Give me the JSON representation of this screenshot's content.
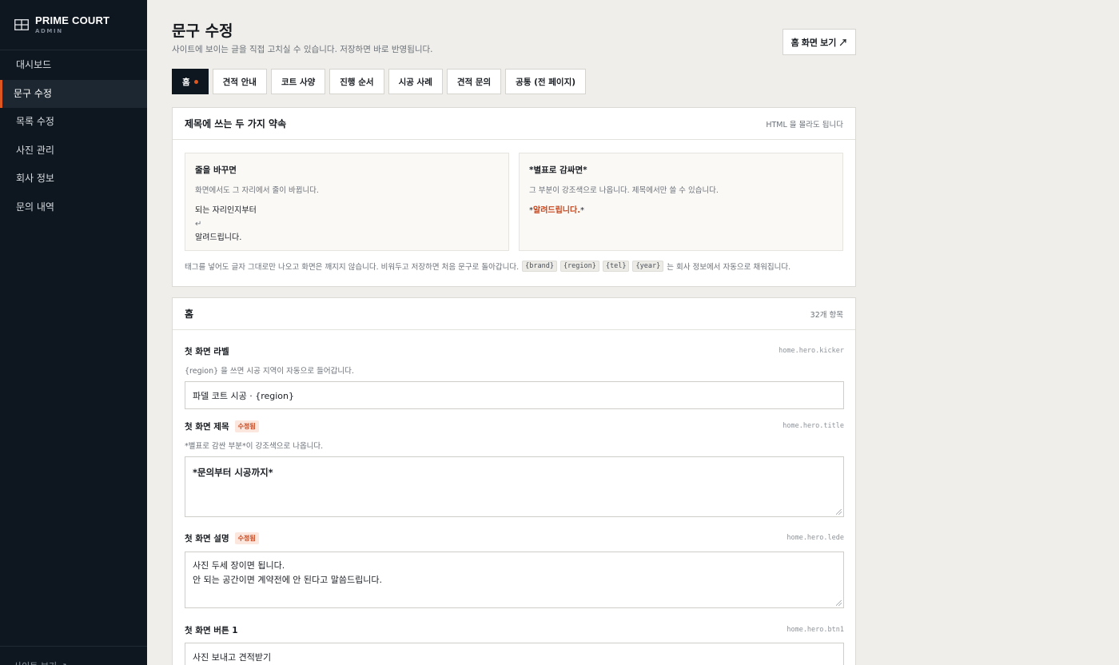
{
  "sidebar": {
    "brand": "PRIME COURT",
    "brand_sub": "ADMIN",
    "logo_icon": "grid-icon",
    "items": [
      {
        "label": "대시보드"
      },
      {
        "label": "문구 수정"
      },
      {
        "label": "목록 수정"
      },
      {
        "label": "사진 관리"
      },
      {
        "label": "회사 정보"
      },
      {
        "label": "문의 내역"
      }
    ],
    "footer_link": "사이트 보기 ↗"
  },
  "header": {
    "title": "문구 수정",
    "subtitle": "사이트에 보이는 글을 직접 고치실 수 있습니다. 저장하면 바로 반영됩니다.",
    "view_button": "홈 화면 보기 ↗"
  },
  "tabs": [
    {
      "label": "홈"
    },
    {
      "label": "견적 안내"
    },
    {
      "label": "코트 사양"
    },
    {
      "label": "진행 순서"
    },
    {
      "label": "시공 사례"
    },
    {
      "label": "견적 문의"
    },
    {
      "label": "공통 (전 페이지)"
    }
  ],
  "rules_card": {
    "title": "제목에 쓰는 두 가지 약속",
    "meta": "HTML 을 몰라도 됩니다",
    "rule1": {
      "title": "줄을 바꾸면",
      "desc": "화면에서도 그 자리에서 줄이 바뀝니다.",
      "ex_line1": "되는 자리인지부터",
      "ex_icon": "↵",
      "ex_line2": "알려드립니다."
    },
    "rule2": {
      "title": "*별표로 감싸면*",
      "desc": "그 부분이 강조색으로 나옵니다. 제목에서만 쓸 수 있습니다.",
      "ex_star_open": "*",
      "ex_accent": "알려드립니다.",
      "ex_star_close": "*"
    },
    "note_before": "태그를 넣어도 글자 그대로만 나오고 화면은 깨지지 않습니다. 비워두고 저장하면 처음 문구로 돌아갑니다.",
    "tokens": [
      "{brand}",
      "{region}",
      "{tel}",
      "{year}"
    ],
    "note_after": "는 회사 정보에서 자동으로 채워집니다."
  },
  "home_card": {
    "title": "홈",
    "count": "32개 항목",
    "fields": [
      {
        "label": "첫 화면 라벨",
        "key": "home.hero.kicker",
        "help": "{region} 을 쓰면 시공 지역이 자동으로 들어갑니다.",
        "value": "파델 코트 시공 · {region}"
      },
      {
        "label": "첫 화면 제목",
        "badge": "수정됨",
        "key": "home.hero.title",
        "help": "*별표로 감싼 부분*이 강조색으로 나옵니다.",
        "value": "*문의부터 시공까지*"
      },
      {
        "label": "첫 화면 설명",
        "badge": "수정됨",
        "key": "home.hero.lede",
        "value_line1": "사진 두세 장이면 됩니다.",
        "value_line2": "안 되는 공간이면 계약전에 안 된다고 말씀드립니다."
      },
      {
        "label": "첫 화면 버튼 1",
        "key": "home.hero.btn1",
        "value": "사진 보내고 견적받기"
      }
    ]
  }
}
